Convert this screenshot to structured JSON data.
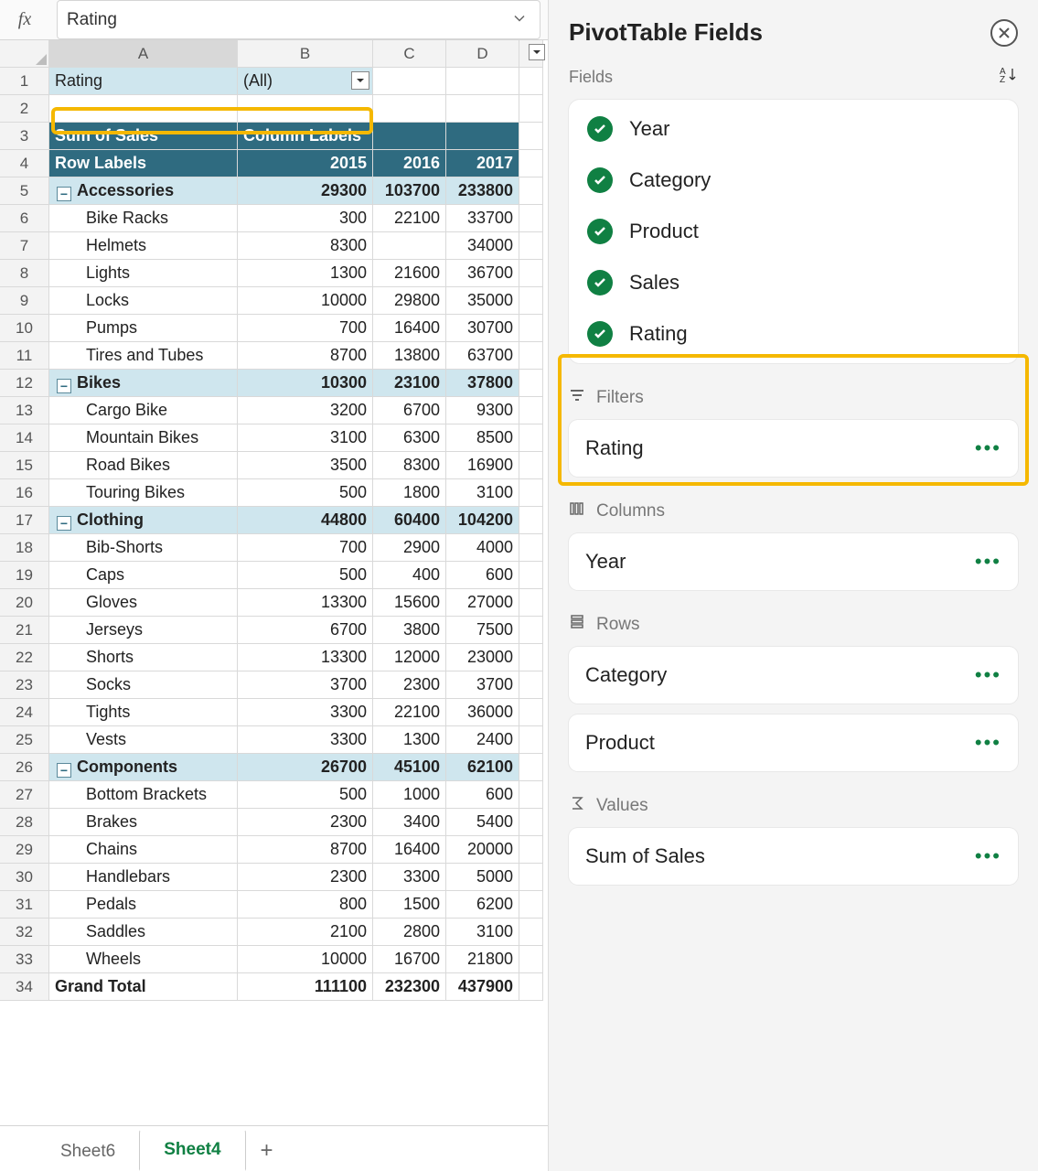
{
  "formula": {
    "text": "Rating"
  },
  "columns": [
    "A",
    "B",
    "C",
    "D",
    ""
  ],
  "pivot": {
    "filter_field": "Rating",
    "filter_value": "(All)",
    "measure_label": "Sum of Sales",
    "col_label": "Column Labels",
    "row_label": "Row Labels",
    "years": [
      "2015",
      "2016",
      "2017"
    ],
    "groups": [
      {
        "name": "Accessories",
        "totals": [
          "29300",
          "103700",
          "233800"
        ],
        "rows": [
          {
            "name": "Bike Racks",
            "v": [
              "300",
              "22100",
              "33700"
            ]
          },
          {
            "name": "Helmets",
            "v": [
              "8300",
              "",
              "34000"
            ]
          },
          {
            "name": "Lights",
            "v": [
              "1300",
              "21600",
              "36700"
            ]
          },
          {
            "name": "Locks",
            "v": [
              "10000",
              "29800",
              "35000"
            ]
          },
          {
            "name": "Pumps",
            "v": [
              "700",
              "16400",
              "30700"
            ]
          },
          {
            "name": "Tires and Tubes",
            "v": [
              "8700",
              "13800",
              "63700"
            ]
          }
        ]
      },
      {
        "name": "Bikes",
        "totals": [
          "10300",
          "23100",
          "37800"
        ],
        "rows": [
          {
            "name": "Cargo Bike",
            "v": [
              "3200",
              "6700",
              "9300"
            ]
          },
          {
            "name": "Mountain Bikes",
            "v": [
              "3100",
              "6300",
              "8500"
            ]
          },
          {
            "name": "Road Bikes",
            "v": [
              "3500",
              "8300",
              "16900"
            ]
          },
          {
            "name": "Touring Bikes",
            "v": [
              "500",
              "1800",
              "3100"
            ]
          }
        ]
      },
      {
        "name": "Clothing",
        "totals": [
          "44800",
          "60400",
          "104200"
        ],
        "rows": [
          {
            "name": "Bib-Shorts",
            "v": [
              "700",
              "2900",
              "4000"
            ]
          },
          {
            "name": "Caps",
            "v": [
              "500",
              "400",
              "600"
            ]
          },
          {
            "name": "Gloves",
            "v": [
              "13300",
              "15600",
              "27000"
            ]
          },
          {
            "name": "Jerseys",
            "v": [
              "6700",
              "3800",
              "7500"
            ]
          },
          {
            "name": "Shorts",
            "v": [
              "13300",
              "12000",
              "23000"
            ]
          },
          {
            "name": "Socks",
            "v": [
              "3700",
              "2300",
              "3700"
            ]
          },
          {
            "name": "Tights",
            "v": [
              "3300",
              "22100",
              "36000"
            ]
          },
          {
            "name": "Vests",
            "v": [
              "3300",
              "1300",
              "2400"
            ]
          }
        ]
      },
      {
        "name": "Components",
        "totals": [
          "26700",
          "45100",
          "62100"
        ],
        "rows": [
          {
            "name": "Bottom Brackets",
            "v": [
              "500",
              "1000",
              "600"
            ]
          },
          {
            "name": "Brakes",
            "v": [
              "2300",
              "3400",
              "5400"
            ]
          },
          {
            "name": "Chains",
            "v": [
              "8700",
              "16400",
              "20000"
            ]
          },
          {
            "name": "Handlebars",
            "v": [
              "2300",
              "3300",
              "5000"
            ]
          },
          {
            "name": "Pedals",
            "v": [
              "800",
              "1500",
              "6200"
            ]
          },
          {
            "name": "Saddles",
            "v": [
              "2100",
              "2800",
              "3100"
            ]
          },
          {
            "name": "Wheels",
            "v": [
              "10000",
              "16700",
              "21800"
            ]
          }
        ]
      }
    ],
    "grand_label": "Grand Total",
    "grand": [
      "111100",
      "232300",
      "437900"
    ]
  },
  "tabs": {
    "items": [
      "Sheet6",
      "Sheet4"
    ],
    "active": 1
  },
  "panel": {
    "title": "PivotTable Fields",
    "fields_label": "Fields",
    "fields": [
      "Year",
      "Category",
      "Product",
      "Sales",
      "Rating"
    ],
    "zones": {
      "filters": {
        "label": "Filters",
        "items": [
          "Rating"
        ]
      },
      "columns": {
        "label": "Columns",
        "items": [
          "Year"
        ]
      },
      "rows": {
        "label": "Rows",
        "items": [
          "Category",
          "Product"
        ]
      },
      "values": {
        "label": "Values",
        "items": [
          "Sum of Sales"
        ]
      }
    }
  }
}
